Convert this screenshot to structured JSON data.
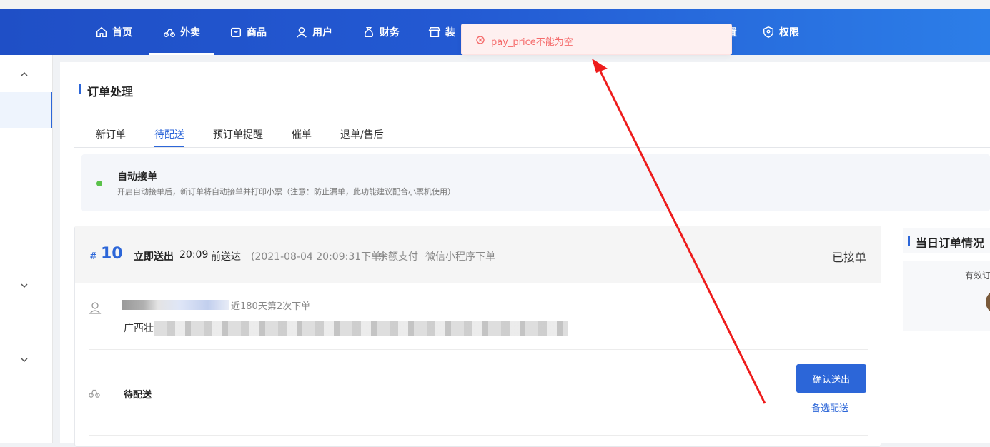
{
  "nav": {
    "items": [
      {
        "label": "首页",
        "icon": "home-icon"
      },
      {
        "label": "外卖",
        "icon": "scooter-icon",
        "active": true
      },
      {
        "label": "商品",
        "icon": "bag-icon"
      },
      {
        "label": "用户",
        "icon": "user-icon"
      },
      {
        "label": "财务",
        "icon": "money-bag-icon"
      },
      {
        "label": "装",
        "icon": "store-icon"
      },
      {
        "label": "权限",
        "icon": "shield-icon"
      }
    ],
    "hidden_partial": "置"
  },
  "toast": {
    "message": "pay_price不能为空",
    "icon": "error-circle-icon",
    "color": "#f56c6c"
  },
  "page": {
    "title": "订单处理"
  },
  "tabs": [
    {
      "label": "新订单"
    },
    {
      "label": "待配送",
      "active": true
    },
    {
      "label": "预订单提醒"
    },
    {
      "label": "催单"
    },
    {
      "label": "退单/售后"
    }
  ],
  "auto_accept": {
    "title": "自动接单",
    "description": "开启自动接单后，新订单将自动接单并打印小票（注意：防止漏单，此功能建议配合小票机使用）"
  },
  "order": {
    "hash": "#",
    "number": "10",
    "delivery_label": "立即送出",
    "delivery_time": "20:09",
    "delivery_before": "前送达",
    "order_time": "(2021-08-04 20:09:31下单)",
    "pay_method": "余额支付",
    "source": "微信小程序下单",
    "status": "已接单",
    "customer_note": "近180天第2次下单",
    "address_prefix": "广西壮",
    "delivery_status": "待配送",
    "confirm_button": "确认送出",
    "alt_delivery": "备选配送"
  },
  "right_panel": {
    "title": "当日订单情况",
    "valid_label": "有效订"
  },
  "colors": {
    "primary": "#2c66d8",
    "nav_start": "#1f4fc6",
    "nav_end": "#2c7ee8",
    "success_dot": "#5ac14a",
    "error": "#f56c6c"
  }
}
